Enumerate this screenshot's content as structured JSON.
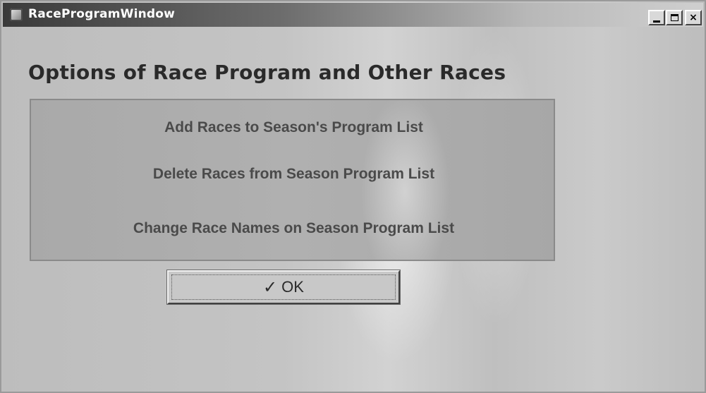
{
  "window": {
    "title": "RaceProgramWindow",
    "controls": {
      "minimize": "_",
      "close": "×"
    }
  },
  "main": {
    "heading": "Options of Race Program  and Other Races",
    "options": [
      {
        "label": "Add Races to Season's Program List"
      },
      {
        "label": "Delete Races from Season Program List"
      },
      {
        "label": "Change Race Names on Season Program List"
      }
    ],
    "ok_button": {
      "icon": "✓",
      "label": "OK"
    }
  }
}
